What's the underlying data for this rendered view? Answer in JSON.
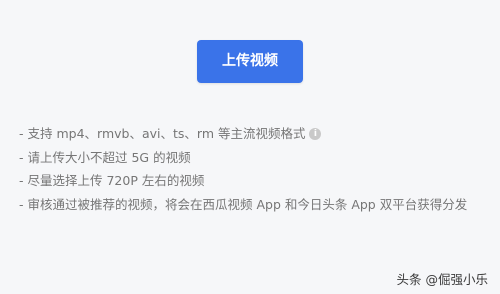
{
  "upload": {
    "button_label": "上传视频"
  },
  "hints": {
    "item1": "- 支持 mp4、rmvb、avi、ts、rm 等主流视频格式",
    "info_icon_symbol": "i",
    "item2": "- 请上传大小不超过 5G 的视频",
    "item3": "- 尽量选择上传 720P 左右的视频",
    "item4": "- 审核通过被推荐的视频，将会在西瓜视频 App 和今日头条 App 双平台获得分发"
  },
  "watermark": {
    "text": "头条 @倔强小乐"
  },
  "colors": {
    "accent": "#3a73e9",
    "background": "#f6f7f9"
  }
}
